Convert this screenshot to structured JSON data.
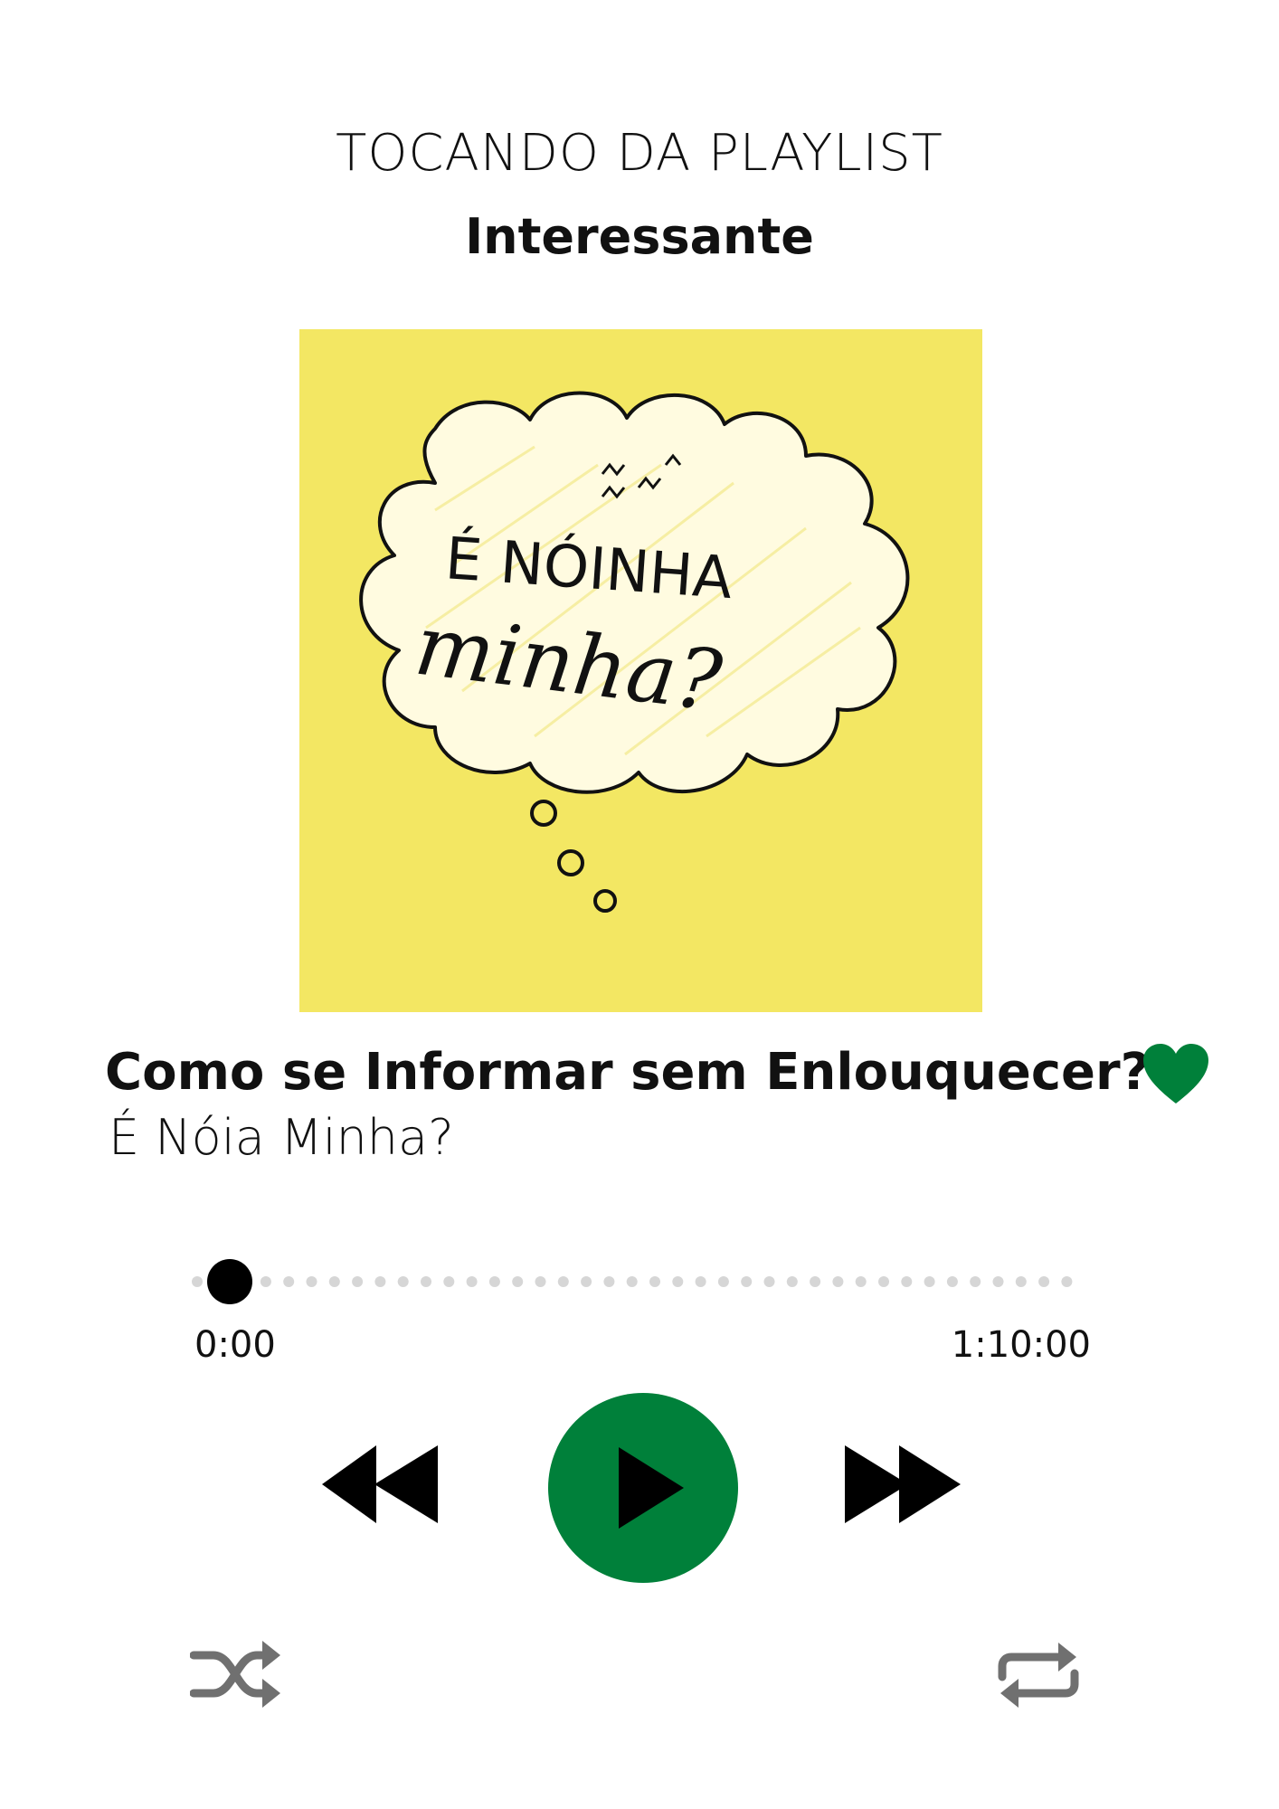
{
  "header": {
    "playing_from": "TOCANDO DA PLAYLIST",
    "playlist_name": "Interessante"
  },
  "cover": {
    "text_line1": "É NÓINHA",
    "text_line2": "minha?",
    "background": "#f3e763"
  },
  "track": {
    "title": "Como se Informar sem Enlouquecer?",
    "artist": "É Nóia Minha?",
    "liked": true
  },
  "progress": {
    "current_time": "0:00",
    "total_time": "1:10:00",
    "fraction": 0.0
  },
  "controls": {
    "rewind_icon": "rewind-icon",
    "play_icon": "play-icon",
    "forward_icon": "fast-forward-icon",
    "shuffle_icon": "shuffle-icon",
    "repeat_icon": "repeat-icon"
  },
  "colors": {
    "accent": "#00803a",
    "text": "#111111",
    "secondary_icon": "#707070",
    "track_dots": "#d6d6d6"
  }
}
